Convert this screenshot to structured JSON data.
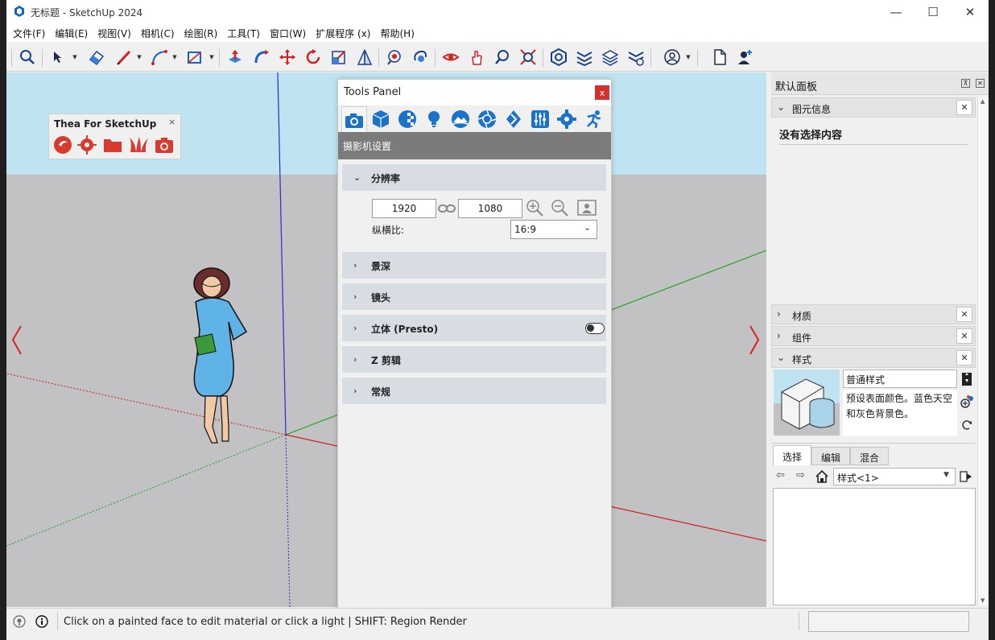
{
  "app": {
    "title": "无标题 - SketchUp 2024"
  },
  "menu": [
    "文件(F)",
    "编辑(E)",
    "视图(V)",
    "相机(C)",
    "绘图(R)",
    "工具(T)",
    "窗口(W)",
    "扩展程序 (x)",
    "帮助(H)"
  ],
  "toolbar": {
    "icons": [
      "search-icon",
      "select-arrow-icon",
      "eraser-icon",
      "pencil-icon",
      "arc-icon",
      "rectangle-icon",
      "push-pull-icon",
      "follow-me-icon",
      "move-icon",
      "rotate-icon",
      "scale-icon",
      "section-plane-icon",
      "paint-bucket-icon",
      "orbit-icon",
      "walk-icon",
      "pan-icon",
      "zoom-icon",
      "zoom-extents-icon",
      "warehouse-icon",
      "extension-warehouse-icon",
      "layout-icon",
      "extension-manager-icon",
      "account-icon",
      "new-file-icon",
      "add-user-icon"
    ]
  },
  "thea": {
    "title": "Thea For SketchUp",
    "close": "×"
  },
  "tools_panel": {
    "title": "Tools Panel",
    "close": "x",
    "section": "摄影机设置",
    "resolution": {
      "label": "分辨率",
      "width": "1920",
      "height": "1080",
      "aspect_label": "纵横比:",
      "aspect_value": "16:9"
    },
    "sections": [
      "景深",
      "镜头",
      "立体 (Presto)",
      "Z 剪辑",
      "常规"
    ]
  },
  "tray": {
    "title": "默认面板",
    "entity_info": {
      "label": "图元信息",
      "empty": "没有选择内容"
    },
    "materials": "材质",
    "components": "组件",
    "styles": {
      "label": "样式",
      "name": "普通样式",
      "description": "预设表面颜色。蓝色天空和灰色背景色。",
      "tabs": [
        "选择",
        "编辑",
        "混合"
      ],
      "collection": "样式<1>"
    }
  },
  "status": {
    "message": "Click on a painted face to edit material or click a light | SHIFT: Region Render"
  },
  "colors": {
    "sky": "#bfe3f1",
    "ground": "#c2c2c4",
    "accent_blue": "#1a73c8",
    "thea_red": "#d83b2e",
    "axis_red": "#cc1f1f",
    "axis_green": "#23a023",
    "axis_blue": "#2a2ad0"
  }
}
